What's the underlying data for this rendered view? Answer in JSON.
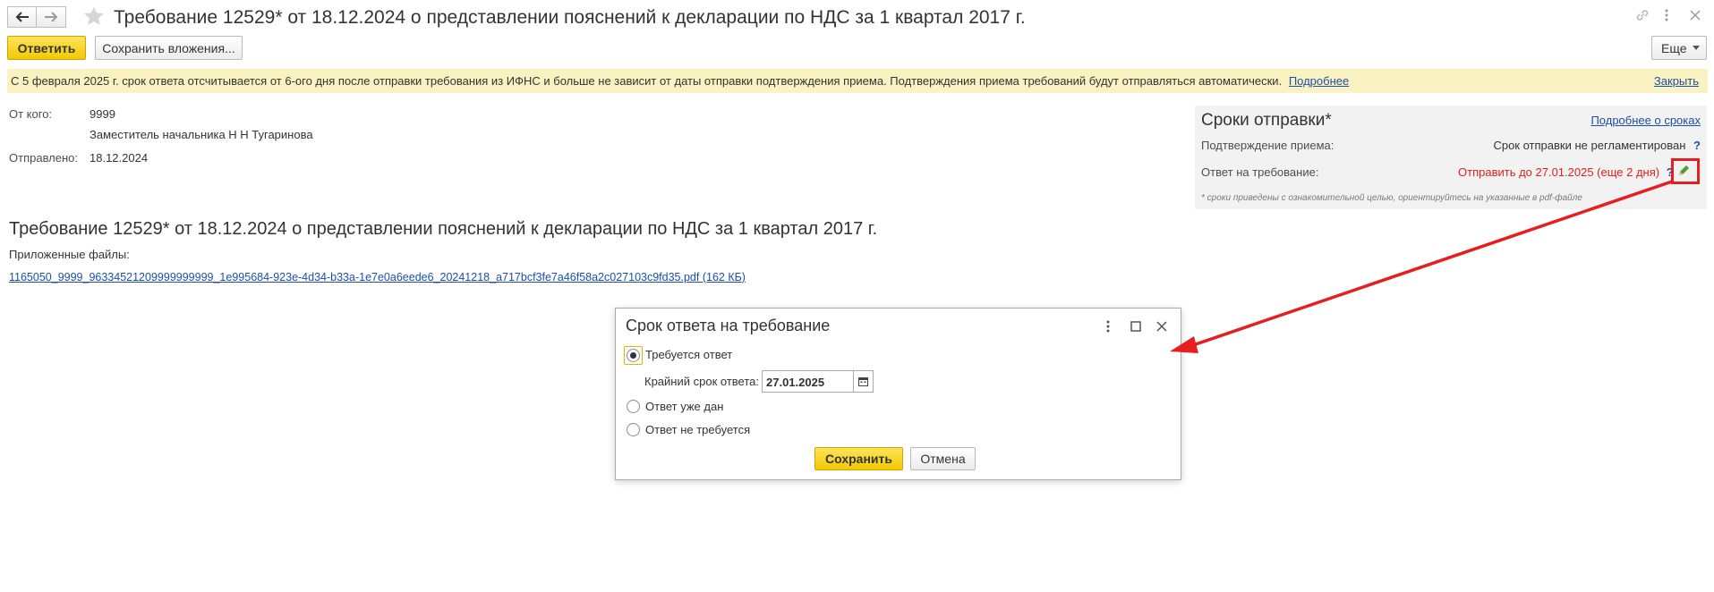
{
  "window": {
    "title": "Требование 12529* от 18.12.2024 о представлении пояснений к декларации по НДС за 1 квартал 2017 г."
  },
  "toolbar": {
    "reply_label": "Ответить",
    "save_attachments_label": "Сохранить вложения...",
    "more_label": "Еще"
  },
  "infobar": {
    "message": "С 5 февраля 2025 г. срок ответа отсчитывается от 6-ого дня после отправки требования из ИФНС и больше не зависит от даты отправки подтверждения приема. Подтверждения приема требований будут отправляться автоматически.",
    "more_link": "Подробнее",
    "close_link": "Закрыть"
  },
  "sender": {
    "from_label": "От кого:",
    "from_code": "9999",
    "from_name": "Заместитель начальника Н Н Тугаринова",
    "sent_label": "Отправлено:",
    "sent_date": "18.12.2024"
  },
  "deadlines": {
    "title": "Сроки отправки*",
    "details_link": "Подробнее о сроках",
    "receipt_label": "Подтверждение приема:",
    "receipt_value": "Срок отправки не регламентирован",
    "answer_label": "Ответ на требование:",
    "answer_value": "Отправить до 27.01.2025 (еще 2 дня)",
    "help_mark": "?",
    "footnote": "* сроки приведены с ознакомительной целью, ориентируйтесь на указанные в pdf-файле",
    "answer_color": "#e0201b"
  },
  "document": {
    "heading": "Требование 12529* от 18.12.2024 о представлении пояснений к декларации по НДС за 1 квартал 2017 г.",
    "files_label": "Приложенные файлы:",
    "file_link": "1165050_9999_96334521209999999999_1e995684-923e-4d34-b33a-1e7e0a6eede6_20241218_a717bcf3fe7a46f58a2c027103c9fd35.pdf (162 КБ)"
  },
  "dialog": {
    "title": "Срок ответа на требование",
    "option_required": "Требуется ответ",
    "deadline_label": "Крайний срок ответа:",
    "deadline_value": "27.01.2025",
    "option_given": "Ответ уже дан",
    "option_not_required": "Ответ не требуется",
    "save_label": "Сохранить",
    "cancel_label": "Отмена",
    "selected_option": "required"
  },
  "icons": {
    "back": "arrow-left-icon",
    "forward": "arrow-right-icon",
    "favorite": "star-icon",
    "link": "link-icon",
    "menu": "vertical-dots-icon",
    "close": "close-icon",
    "edit": "pencil-icon",
    "calendar": "calendar-icon",
    "maximize": "maximize-icon"
  },
  "colors": {
    "accent_yellow": "#f5cf0c",
    "link_blue": "#1c4fa8",
    "infobar_bg": "#fbf2c2",
    "annotation_red": "#e61e1e"
  }
}
